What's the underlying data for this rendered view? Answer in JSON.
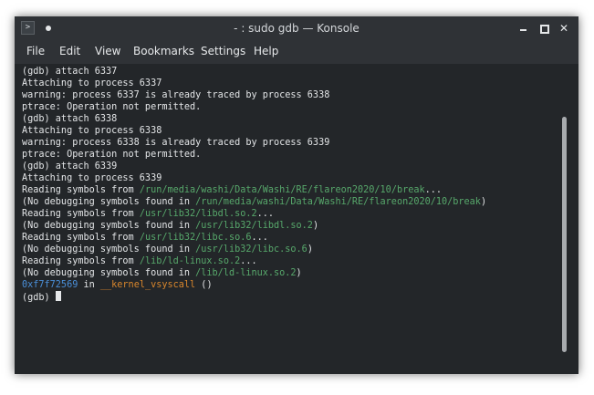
{
  "window": {
    "title": "- : sudo gdb — Konsole",
    "app_icon_glyph": ">",
    "controls": {
      "close_glyph": "✕"
    }
  },
  "menu": [
    "File",
    "Edit",
    "View",
    "Bookmarks",
    "Settings",
    "Help"
  ],
  "terminal": {
    "lines": [
      [
        {
          "t": "(gdb) attach 6337",
          "c": "text"
        }
      ],
      [
        {
          "t": "Attaching to process 6337",
          "c": "text"
        }
      ],
      [
        {
          "t": "warning: process 6337 is already traced by process 6338",
          "c": "text"
        }
      ],
      [
        {
          "t": "ptrace: Operation not permitted.",
          "c": "text"
        }
      ],
      [
        {
          "t": "(gdb) attach 6338",
          "c": "text"
        }
      ],
      [
        {
          "t": "Attaching to process 6338",
          "c": "text"
        }
      ],
      [
        {
          "t": "warning: process 6338 is already traced by process 6339",
          "c": "text"
        }
      ],
      [
        {
          "t": "ptrace: Operation not permitted.",
          "c": "text"
        }
      ],
      [
        {
          "t": "(gdb) attach 6339",
          "c": "text"
        }
      ],
      [
        {
          "t": "Attaching to process 6339",
          "c": "text"
        }
      ],
      [
        {
          "t": "Reading symbols from ",
          "c": "text"
        },
        {
          "t": "/run/media/washi/Data/Washi/RE/flareon2020/10/break",
          "c": "path"
        },
        {
          "t": "...",
          "c": "text"
        }
      ],
      [
        {
          "t": "(No debugging symbols found in ",
          "c": "text"
        },
        {
          "t": "/run/media/washi/Data/Washi/RE/flareon2020/10/break",
          "c": "path"
        },
        {
          "t": ")",
          "c": "text"
        }
      ],
      [
        {
          "t": "Reading symbols from ",
          "c": "text"
        },
        {
          "t": "/usr/lib32/libdl.so.2",
          "c": "path"
        },
        {
          "t": "...",
          "c": "text"
        }
      ],
      [
        {
          "t": "(No debugging symbols found in ",
          "c": "text"
        },
        {
          "t": "/usr/lib32/libdl.so.2",
          "c": "path"
        },
        {
          "t": ")",
          "c": "text"
        }
      ],
      [
        {
          "t": "Reading symbols from ",
          "c": "text"
        },
        {
          "t": "/usr/lib32/libc.so.6",
          "c": "path"
        },
        {
          "t": "...",
          "c": "text"
        }
      ],
      [
        {
          "t": "(No debugging symbols found in ",
          "c": "text"
        },
        {
          "t": "/usr/lib32/libc.so.6",
          "c": "path"
        },
        {
          "t": ")",
          "c": "text"
        }
      ],
      [
        {
          "t": "Reading symbols from ",
          "c": "text"
        },
        {
          "t": "/lib/ld-linux.so.2",
          "c": "path"
        },
        {
          "t": "...",
          "c": "text"
        }
      ],
      [
        {
          "t": "(No debugging symbols found in ",
          "c": "text"
        },
        {
          "t": "/lib/ld-linux.so.2",
          "c": "path"
        },
        {
          "t": ")",
          "c": "text"
        }
      ],
      [
        {
          "t": "0xf7f72569",
          "c": "addr"
        },
        {
          "t": " in ",
          "c": "text"
        },
        {
          "t": "__kernel_vsyscall",
          "c": "func"
        },
        {
          "t": " ()",
          "c": "text"
        }
      ]
    ],
    "prompt": "(gdb) "
  },
  "colors": {
    "background": "#232629",
    "text": "#e3e5e7",
    "path": "#57a86b",
    "address": "#4a8fd9",
    "function": "#d8862c"
  }
}
